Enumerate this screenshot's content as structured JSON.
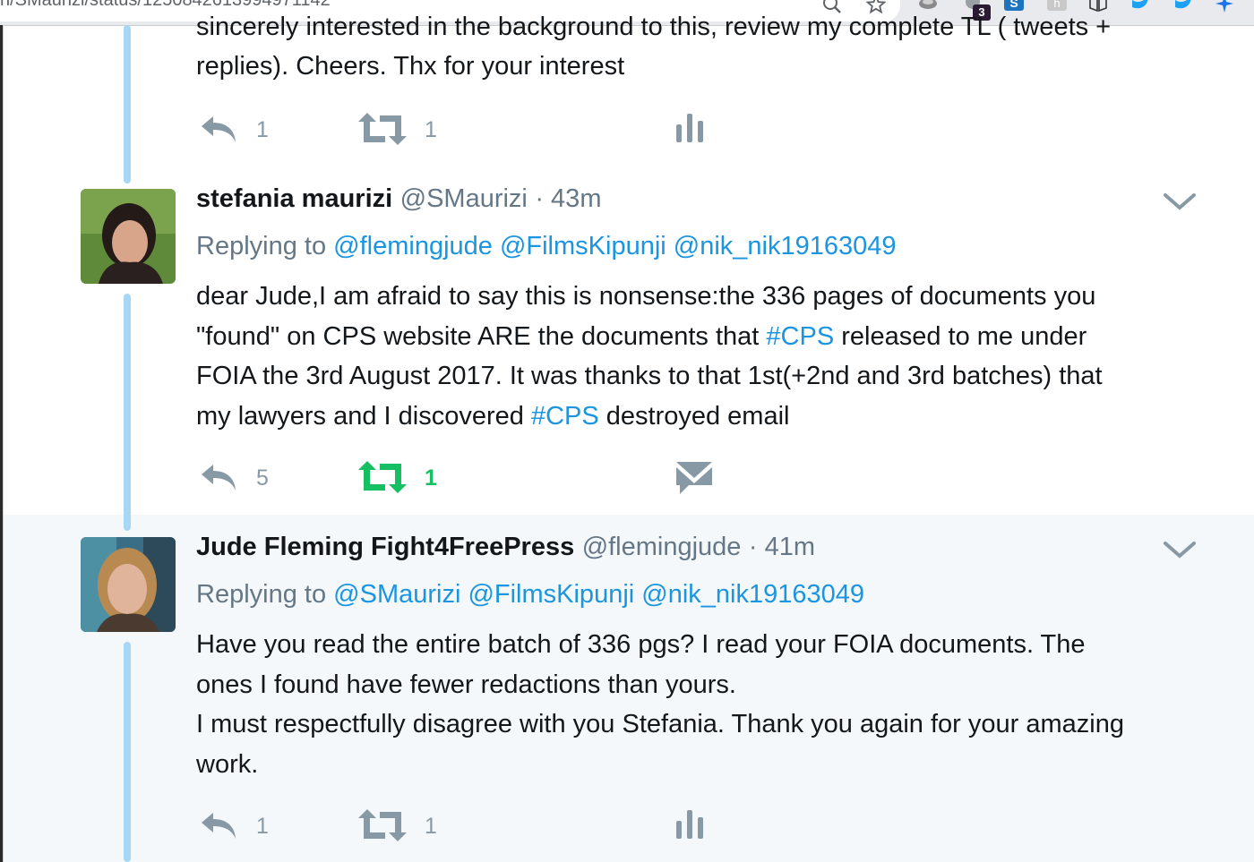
{
  "browser": {
    "url": "n/SMaurizi/status/1250842613994971142",
    "badge_count": "3",
    "icons": [
      "zoom-icon",
      "star-icon",
      "extension-icon",
      "extension-badge-icon",
      "extension-s-icon",
      "extension-h-icon",
      "reading-list-icon",
      "twitter-extension-icon",
      "twitter-extension-icon-2",
      "sparkle-icon"
    ]
  },
  "tweets": [
    {
      "partial_text_line1": "sincerely interested in the background to this, review my complete TL ( tweets +",
      "partial_text_line2": "replies). Cheers. Thx for your interest",
      "reply_count": "1",
      "retweet_count": "1",
      "action_icons": [
        "reply-icon",
        "retweet-icon",
        "analytics-icon"
      ]
    },
    {
      "name": "stefania maurizi",
      "handle": "@SMaurizi",
      "time": "· 43m",
      "replying_label": "Replying to",
      "replying_to": "@flemingjude @FilmsKipunji @nik_nik19163049",
      "text": {
        "l1": "dear Jude,I am afraid to say this is nonsense:the 336 pages of documents you",
        "l2a": "\"found\" on CPS website ARE the documents that ",
        "l2h": "#CPS",
        "l2b": " released to me under",
        "l3": "FOIA the 3rd August 2017. It was thanks to that 1st(+2nd and 3rd batches) that",
        "l4a": "my lawyers and I discovered ",
        "l4h": "#CPS",
        "l4b": " destroyed email"
      },
      "reply_count": "5",
      "retweet_count": "1",
      "retweeted": true,
      "colors": {
        "retweeted": "#17bf63"
      },
      "action_icons": [
        "reply-icon",
        "retweet-icon",
        "direct-message-icon"
      ]
    },
    {
      "name": "Jude Fleming Fight4FreePress",
      "handle": "@flemingjude",
      "time": "· 41m",
      "replying_label": "Replying to",
      "replying_to": "@SMaurizi @FilmsKipunji @nik_nik19163049",
      "text": {
        "l1": "Have you read the entire batch of 336 pgs? I read your FOIA documents. The",
        "l2": "ones I found have fewer redactions than yours.",
        "l3": "I must respectfully disagree with you Stefania. Thank you again for your amazing",
        "l4": "work."
      },
      "reply_count": "1",
      "retweet_count": "1",
      "action_icons": [
        "reply-icon",
        "retweet-icon",
        "analytics-icon"
      ]
    }
  ],
  "colors": {
    "link": "#1b95e0",
    "thread_line": "#a8d7f6",
    "muted": "#657786",
    "icon": "#8899a6",
    "highlight_bg": "#f5f8fa"
  }
}
